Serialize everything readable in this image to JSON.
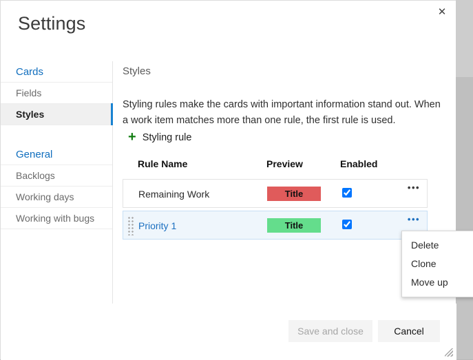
{
  "dialog": {
    "title": "Settings",
    "close_label": "✕"
  },
  "sidebar": {
    "groups": [
      {
        "label": "Cards"
      },
      {
        "label": "General"
      }
    ],
    "items": [
      {
        "label": "Fields",
        "selected": false
      },
      {
        "label": "Styles",
        "selected": true
      },
      {
        "label": "Backlogs",
        "selected": false
      },
      {
        "label": "Working days",
        "selected": false
      },
      {
        "label": "Working with bugs",
        "selected": false
      }
    ]
  },
  "content": {
    "heading": "Styles",
    "description": "Styling rules make the cards with important information stand out. When a work item matches more than one rule, the first rule is used.",
    "add_rule_label": "Styling rule",
    "add_rule_icon": "plus-icon",
    "plus_color": "#107c10"
  },
  "table": {
    "columns": [
      "Rule Name",
      "Preview",
      "Enabled"
    ],
    "rows": [
      {
        "name": "Remaining Work",
        "preview_text": "Title",
        "preview_color": "#e05b5b",
        "enabled": true,
        "selected": false,
        "menu_label": "•••"
      },
      {
        "name": "Priority 1",
        "preview_text": "Title",
        "preview_color": "#64dd8c",
        "enabled": true,
        "selected": true,
        "menu_label": "•••"
      }
    ]
  },
  "context_menu": {
    "visible": true,
    "items": [
      "Delete",
      "Clone",
      "Move up"
    ]
  },
  "footer": {
    "save_label": "Save and close",
    "save_disabled": true,
    "cancel_label": "Cancel"
  },
  "colors": {
    "accent": "#1982d1",
    "link": "#106ebe",
    "selected_row_bg": "#eff6fc",
    "selected_row_text": "#1b6fc0"
  }
}
